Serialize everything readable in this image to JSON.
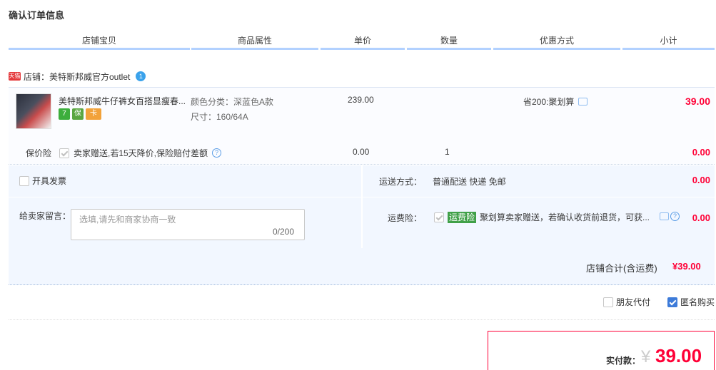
{
  "title": "确认订单信息",
  "columns": [
    "店铺宝贝",
    "商品属性",
    "单价",
    "数量",
    "优惠方式",
    "小计"
  ],
  "shop": {
    "badge": "天猫",
    "name": "店铺：美特斯邦威官方outlet",
    "chat_glyph": "1"
  },
  "item": {
    "name": "美特斯邦威牛仔裤女百搭显瘦春...",
    "attr_color": "颜色分类：深蓝色A款",
    "attr_size": "尺寸：160/64A",
    "price": "239.00",
    "promo": "省200:聚划算",
    "subtotal": "39.00",
    "badges": [
      "7",
      "保",
      "卡"
    ]
  },
  "insurance": {
    "label": "保价险",
    "text": "卖家赠送,若15天降价,保险赔付差额",
    "price": "0.00",
    "qty": "1",
    "subtotal": "0.00"
  },
  "invoice": {
    "label": "开具发票"
  },
  "shipping": {
    "label": "运送方式：",
    "value": "普通配送 快递 免邮",
    "subtotal": "0.00"
  },
  "message": {
    "label": "给卖家留言：",
    "placeholder": "选填,请先和商家协商一致",
    "count": "0/200"
  },
  "freight_ins": {
    "label": "运费险：",
    "tag": "运费险",
    "desc": "聚划算卖家赠送，若确认收货前退货，可获...",
    "subtotal": "0.00"
  },
  "shop_total": {
    "label": "店铺合计(含运费)",
    "value": "¥39.00"
  },
  "options": {
    "friend_pay": "朋友代付",
    "anonymous": "匿名购买"
  },
  "pay": {
    "label": "实付款：",
    "yen": "¥",
    "value": "39.00"
  },
  "colors": {
    "accent": "#ff0036",
    "header_line": "#b2d1ff",
    "panel_bg": "#f2f7ff",
    "tag_green": "#40a048"
  }
}
